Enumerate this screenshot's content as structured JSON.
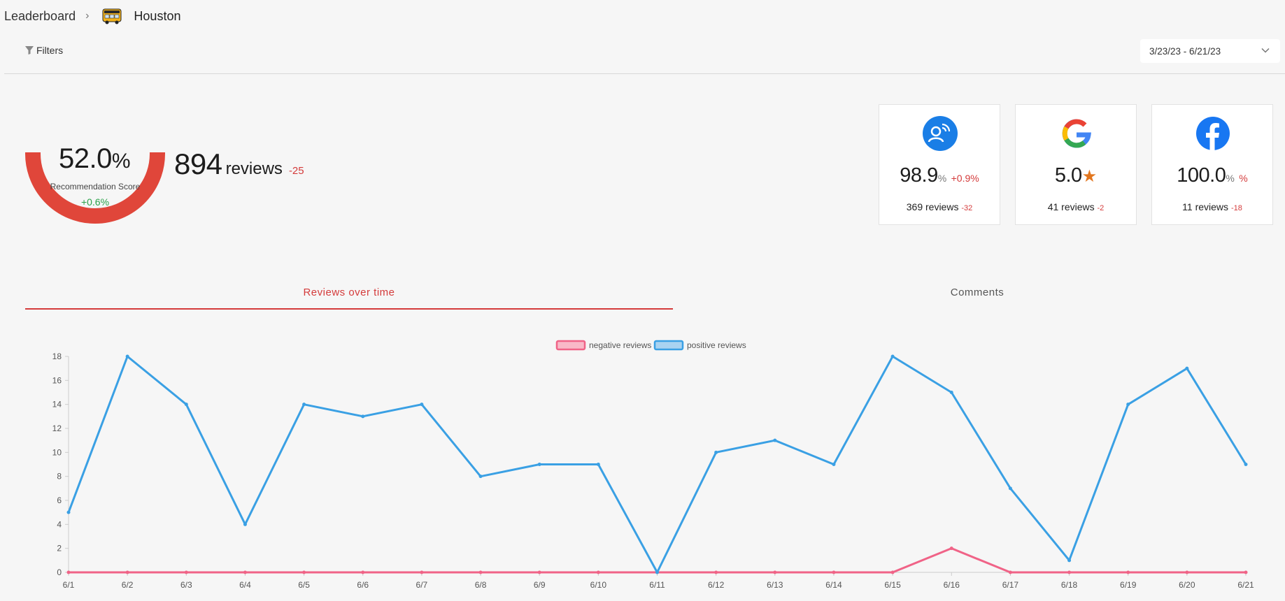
{
  "breadcrumb": {
    "root": "Leaderboard",
    "current": "Houston"
  },
  "toolbar": {
    "filters_label": "Filters",
    "date_range": "3/23/23 - 6/21/23"
  },
  "summary": {
    "score": "52.0",
    "score_unit": "%",
    "score_label": "Recommendation Score",
    "score_change": "+0.6%",
    "gauge_fraction": 0.52,
    "reviews_count": "894",
    "reviews_word": "reviews",
    "reviews_change": "-25"
  },
  "sources": [
    {
      "icon": "podium-icon",
      "value": "98.9",
      "unit": "%",
      "change": "+0.9%",
      "reviews": "369 reviews",
      "reviews_change": "-32",
      "color": "#1a7ee6"
    },
    {
      "icon": "google-icon",
      "value": "5.0",
      "unit": "★",
      "change": "",
      "reviews": "41 reviews",
      "reviews_change": "-2",
      "color": "#4285f4"
    },
    {
      "icon": "facebook-icon",
      "value": "100.0",
      "unit": "%",
      "change": "%",
      "reviews": "11 reviews",
      "reviews_change": "-18",
      "color": "#1877f2"
    }
  ],
  "tabs": [
    {
      "label": "Reviews over time",
      "active": true
    },
    {
      "label": "Comments",
      "active": false
    }
  ],
  "colors": {
    "accent": "#d43b3b",
    "gauge": "#e0463a",
    "positive": "#3aa0e4",
    "negative": "#f06387",
    "up": "#2ba24a"
  },
  "chart_data": {
    "type": "line",
    "x": [
      "6/1",
      "6/2",
      "6/3",
      "6/4",
      "6/5",
      "6/6",
      "6/7",
      "6/8",
      "6/9",
      "6/10",
      "6/11",
      "6/12",
      "6/13",
      "6/14",
      "6/15",
      "6/16",
      "6/17",
      "6/18",
      "6/19",
      "6/20",
      "6/21"
    ],
    "series": [
      {
        "name": "negative reviews",
        "color": "#f06387",
        "values": [
          0,
          0,
          0,
          0,
          0,
          0,
          0,
          0,
          0,
          0,
          0,
          0,
          0,
          0,
          0,
          2,
          0,
          0,
          0,
          0,
          0
        ]
      },
      {
        "name": "positive reviews",
        "color": "#3aa0e4",
        "values": [
          5,
          18,
          14,
          4,
          14,
          13,
          14,
          8,
          9,
          9,
          0,
          10,
          11,
          9,
          18,
          15,
          7,
          1,
          14,
          17,
          9
        ]
      }
    ],
    "yticks": [
      0,
      2,
      4,
      6,
      8,
      10,
      12,
      14,
      16,
      18
    ],
    "ylim": [
      0,
      18
    ],
    "legend": "top-center",
    "grid": false
  }
}
